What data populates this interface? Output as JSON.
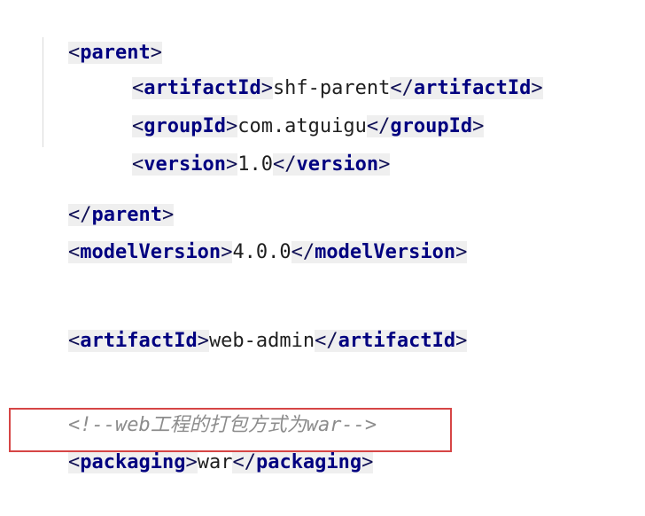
{
  "code": {
    "lines": [
      {
        "open": "parent"
      },
      {
        "open": "artifactId",
        "value": "shf-parent",
        "close": "artifactId"
      },
      {
        "open": "groupId",
        "value": "com.atguigu",
        "close": "groupId"
      },
      {
        "open": "version",
        "value": "1.0",
        "close": "version"
      },
      {
        "close": "parent"
      },
      {
        "open": "modelVersion",
        "value": "4.0.0",
        "close": "modelVersion"
      },
      {
        "open": "artifactId",
        "value": "web-admin",
        "close": "artifactId"
      },
      {
        "comment": "<!--web工程的打包方式为war-->"
      },
      {
        "open": "packaging",
        "value": "war",
        "close": "packaging"
      }
    ]
  },
  "colors": {
    "tag_name": "#000080",
    "tag_background": "#efefef",
    "comment": "#8c8c8c",
    "highlight_border": "#d64545"
  }
}
